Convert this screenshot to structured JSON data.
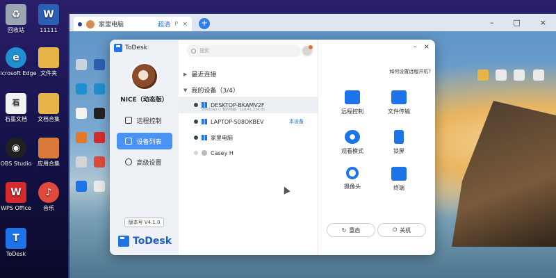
{
  "host_desktop": {
    "icons": [
      {
        "label": "回收站",
        "icon": "recycle-bin-icon",
        "color": "#9aa6b2"
      },
      {
        "label": "11111",
        "icon": "word-doc-icon",
        "color": "#2b5fb4"
      },
      {
        "label": "Microsoft Edge",
        "icon": "edge-icon",
        "color": "#1f8fcf"
      },
      {
        "label": "文件夹",
        "icon": "folder-icon",
        "color": "#e6b54a"
      },
      {
        "label": "石墨文档",
        "icon": "shimo-icon",
        "color": "#f2f2f2"
      },
      {
        "label": "文档合集",
        "icon": "folder-icon",
        "color": "#e6b54a"
      },
      {
        "label": "OBS Studio",
        "icon": "obs-icon",
        "color": "#202020"
      },
      {
        "label": "应用合集",
        "icon": "folder-icon",
        "color": "#d97a3a"
      },
      {
        "label": "WPS Office",
        "icon": "wps-icon",
        "color": "#d42c2c"
      },
      {
        "label": "音乐",
        "icon": "music-icon",
        "color": "#e04a3d"
      },
      {
        "label": "ToDesk",
        "icon": "todesk-icon",
        "color": "#1c74e8"
      }
    ]
  },
  "remote_window": {
    "tab": {
      "title": "家里电脑",
      "quality": "超清",
      "p": "P",
      "close": "×"
    },
    "add_tab": "+",
    "controls": {
      "minimize": "–",
      "maximize": "□",
      "close": "×"
    }
  },
  "todesk": {
    "brand": "ToDesk",
    "user": {
      "name": "NICE（动态版）"
    },
    "nav": [
      {
        "label": "远程控制",
        "active": false
      },
      {
        "label": "设备列表",
        "active": true
      },
      {
        "label": "高级设置",
        "active": false
      }
    ],
    "version": "版本号 V4.1.0",
    "search": {
      "placeholder": "搜索"
    },
    "groups": {
      "recent": "最近连接",
      "mine": "我的设备（3/4）"
    },
    "devices": [
      {
        "name": "DESKTOP-BKAMV2F",
        "sub": "Windows    ○ 我的电脑 · 118.41.236.85",
        "online": true,
        "os": "windows",
        "me": ""
      },
      {
        "name": "LAPTOP-S08OKBEV",
        "sub": "",
        "online": true,
        "os": "windows",
        "me": "本设备"
      },
      {
        "name": "家里电脑",
        "sub": "",
        "online": true,
        "os": "windows",
        "me": ""
      },
      {
        "name": "Casey H",
        "sub": "",
        "online": false,
        "os": "mac",
        "me": ""
      }
    ],
    "window_controls": {
      "minimize": "–",
      "close": "×"
    },
    "howto": "如何设置远程开机?",
    "actions": [
      {
        "label": "远程控制",
        "icon": "remote-control-icon"
      },
      {
        "label": "文件传输",
        "icon": "file-transfer-icon"
      },
      {
        "label": "观看模式",
        "icon": "eye-icon"
      },
      {
        "label": "锁屏",
        "icon": "lock-icon"
      },
      {
        "label": "摄像头",
        "icon": "camera-icon"
      },
      {
        "label": "终端",
        "icon": "terminal-icon"
      }
    ],
    "restart": "重启",
    "shutdown": "关机"
  }
}
